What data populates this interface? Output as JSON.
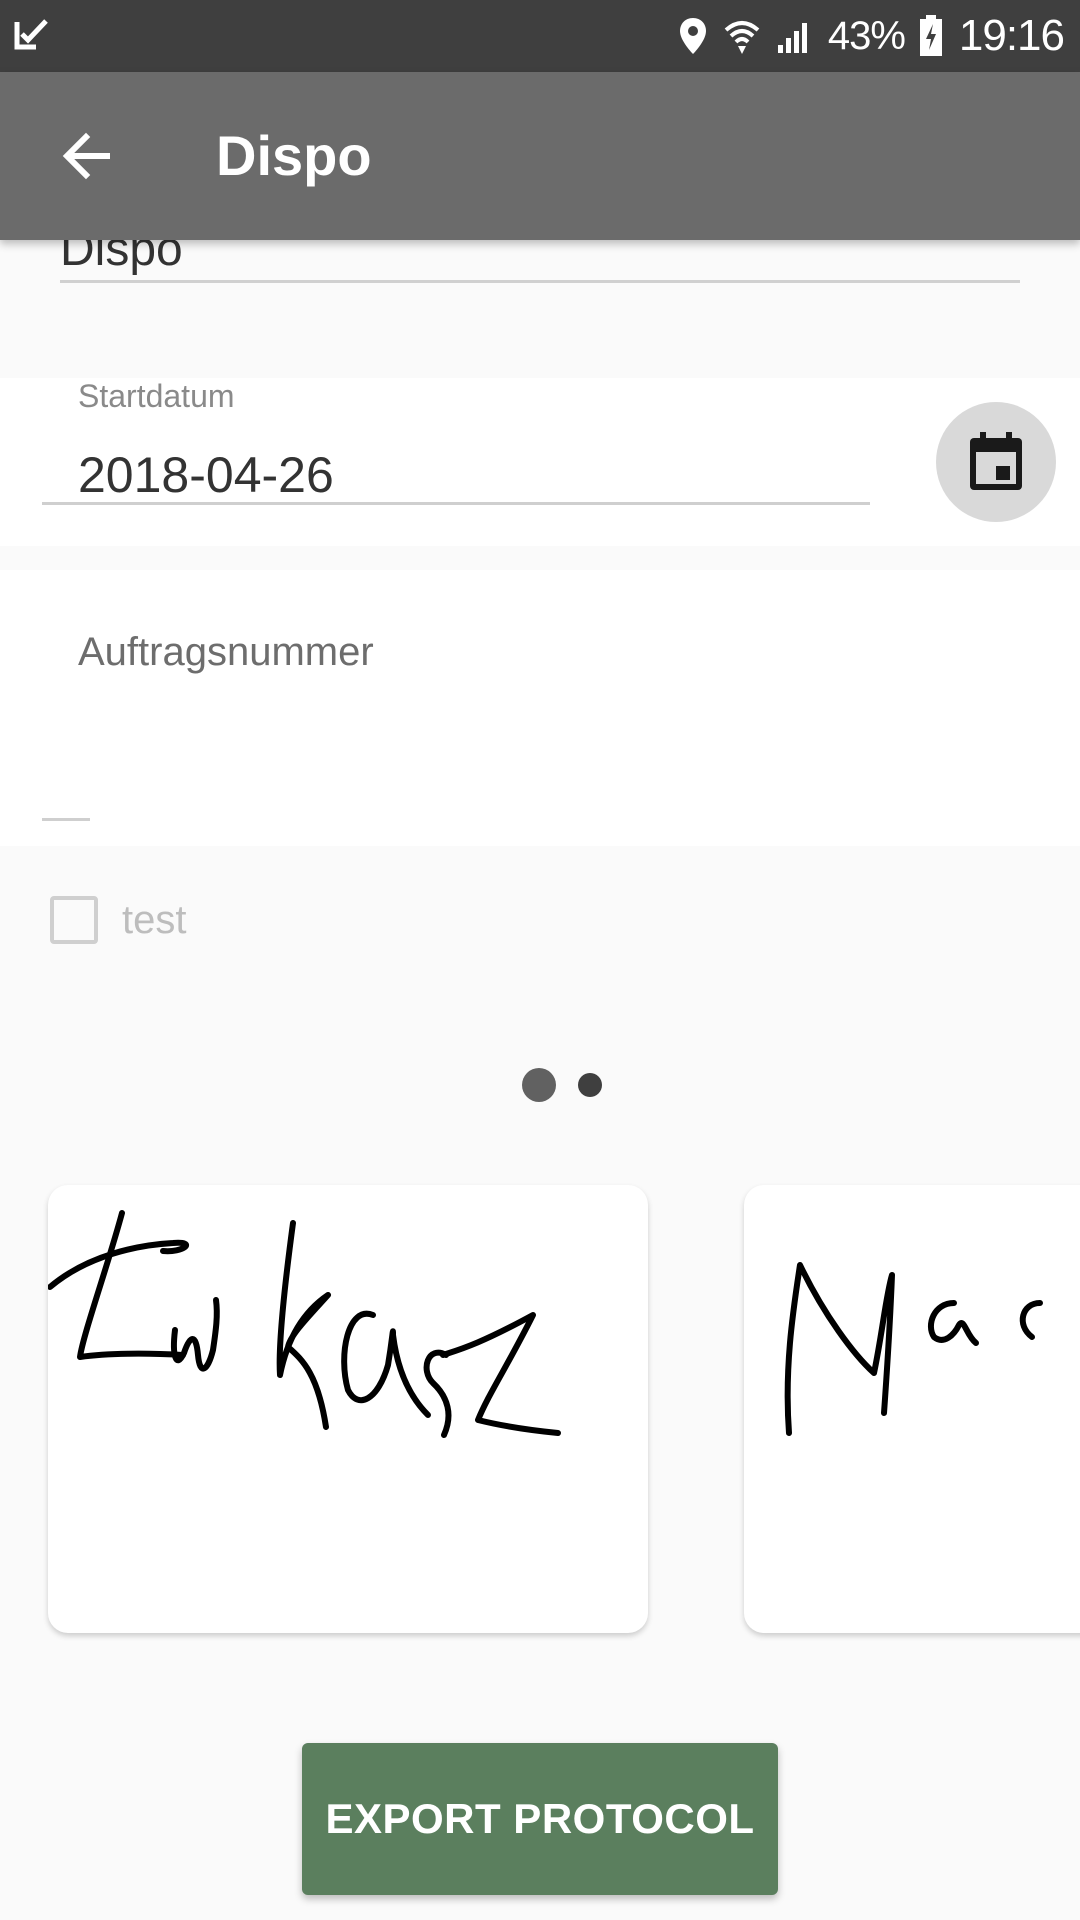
{
  "status_bar": {
    "battery": "43%",
    "time": "19:16",
    "icons": [
      "check-notification-icon",
      "location-icon",
      "wifi-icon",
      "signal-icon",
      "battery-charging-icon"
    ]
  },
  "app_bar": {
    "title": "Dispo",
    "back_icon": "arrow-left-icon"
  },
  "form": {
    "top_field_value": "Dispo",
    "start_date": {
      "label": "Startdatum",
      "value": "2018-04-26",
      "button_icon": "calendar-icon"
    },
    "order_number": {
      "label": "Auftragsnummer",
      "value": ""
    },
    "checkbox": {
      "label": "test",
      "checked": false
    }
  },
  "signatures": {
    "page_indicator": {
      "count": 2,
      "active": 0
    },
    "items": [
      {
        "signature": "Lukasz"
      },
      {
        "signature": "Mac"
      }
    ]
  },
  "export_button": {
    "label": "EXPORT PROTOCOL"
  },
  "colors": {
    "app_bar": "#6b6b6b",
    "status_bar": "#3f3f3f",
    "export_button": "#5b7f5e",
    "background": "#fafafa"
  }
}
